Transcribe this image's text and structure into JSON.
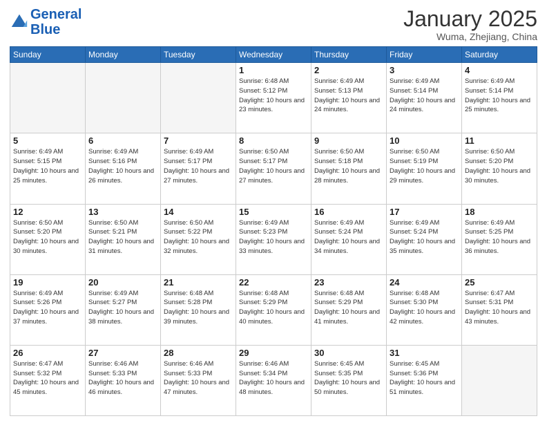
{
  "header": {
    "logo_line1": "General",
    "logo_line2": "Blue",
    "month": "January 2025",
    "location": "Wuma, Zhejiang, China"
  },
  "weekdays": [
    "Sunday",
    "Monday",
    "Tuesday",
    "Wednesday",
    "Thursday",
    "Friday",
    "Saturday"
  ],
  "weeks": [
    [
      {
        "day": "",
        "empty": true
      },
      {
        "day": "",
        "empty": true
      },
      {
        "day": "",
        "empty": true
      },
      {
        "day": "1",
        "sunrise": "6:48 AM",
        "sunset": "5:12 PM",
        "daylight": "10 hours and 23 minutes."
      },
      {
        "day": "2",
        "sunrise": "6:49 AM",
        "sunset": "5:13 PM",
        "daylight": "10 hours and 24 minutes."
      },
      {
        "day": "3",
        "sunrise": "6:49 AM",
        "sunset": "5:14 PM",
        "daylight": "10 hours and 24 minutes."
      },
      {
        "day": "4",
        "sunrise": "6:49 AM",
        "sunset": "5:14 PM",
        "daylight": "10 hours and 25 minutes."
      }
    ],
    [
      {
        "day": "5",
        "sunrise": "6:49 AM",
        "sunset": "5:15 PM",
        "daylight": "10 hours and 25 minutes."
      },
      {
        "day": "6",
        "sunrise": "6:49 AM",
        "sunset": "5:16 PM",
        "daylight": "10 hours and 26 minutes."
      },
      {
        "day": "7",
        "sunrise": "6:49 AM",
        "sunset": "5:17 PM",
        "daylight": "10 hours and 27 minutes."
      },
      {
        "day": "8",
        "sunrise": "6:50 AM",
        "sunset": "5:17 PM",
        "daylight": "10 hours and 27 minutes."
      },
      {
        "day": "9",
        "sunrise": "6:50 AM",
        "sunset": "5:18 PM",
        "daylight": "10 hours and 28 minutes."
      },
      {
        "day": "10",
        "sunrise": "6:50 AM",
        "sunset": "5:19 PM",
        "daylight": "10 hours and 29 minutes."
      },
      {
        "day": "11",
        "sunrise": "6:50 AM",
        "sunset": "5:20 PM",
        "daylight": "10 hours and 30 minutes."
      }
    ],
    [
      {
        "day": "12",
        "sunrise": "6:50 AM",
        "sunset": "5:20 PM",
        "daylight": "10 hours and 30 minutes."
      },
      {
        "day": "13",
        "sunrise": "6:50 AM",
        "sunset": "5:21 PM",
        "daylight": "10 hours and 31 minutes."
      },
      {
        "day": "14",
        "sunrise": "6:50 AM",
        "sunset": "5:22 PM",
        "daylight": "10 hours and 32 minutes."
      },
      {
        "day": "15",
        "sunrise": "6:49 AM",
        "sunset": "5:23 PM",
        "daylight": "10 hours and 33 minutes."
      },
      {
        "day": "16",
        "sunrise": "6:49 AM",
        "sunset": "5:24 PM",
        "daylight": "10 hours and 34 minutes."
      },
      {
        "day": "17",
        "sunrise": "6:49 AM",
        "sunset": "5:24 PM",
        "daylight": "10 hours and 35 minutes."
      },
      {
        "day": "18",
        "sunrise": "6:49 AM",
        "sunset": "5:25 PM",
        "daylight": "10 hours and 36 minutes."
      }
    ],
    [
      {
        "day": "19",
        "sunrise": "6:49 AM",
        "sunset": "5:26 PM",
        "daylight": "10 hours and 37 minutes."
      },
      {
        "day": "20",
        "sunrise": "6:49 AM",
        "sunset": "5:27 PM",
        "daylight": "10 hours and 38 minutes."
      },
      {
        "day": "21",
        "sunrise": "6:48 AM",
        "sunset": "5:28 PM",
        "daylight": "10 hours and 39 minutes."
      },
      {
        "day": "22",
        "sunrise": "6:48 AM",
        "sunset": "5:29 PM",
        "daylight": "10 hours and 40 minutes."
      },
      {
        "day": "23",
        "sunrise": "6:48 AM",
        "sunset": "5:29 PM",
        "daylight": "10 hours and 41 minutes."
      },
      {
        "day": "24",
        "sunrise": "6:48 AM",
        "sunset": "5:30 PM",
        "daylight": "10 hours and 42 minutes."
      },
      {
        "day": "25",
        "sunrise": "6:47 AM",
        "sunset": "5:31 PM",
        "daylight": "10 hours and 43 minutes."
      }
    ],
    [
      {
        "day": "26",
        "sunrise": "6:47 AM",
        "sunset": "5:32 PM",
        "daylight": "10 hours and 45 minutes."
      },
      {
        "day": "27",
        "sunrise": "6:46 AM",
        "sunset": "5:33 PM",
        "daylight": "10 hours and 46 minutes."
      },
      {
        "day": "28",
        "sunrise": "6:46 AM",
        "sunset": "5:33 PM",
        "daylight": "10 hours and 47 minutes."
      },
      {
        "day": "29",
        "sunrise": "6:46 AM",
        "sunset": "5:34 PM",
        "daylight": "10 hours and 48 minutes."
      },
      {
        "day": "30",
        "sunrise": "6:45 AM",
        "sunset": "5:35 PM",
        "daylight": "10 hours and 50 minutes."
      },
      {
        "day": "31",
        "sunrise": "6:45 AM",
        "sunset": "5:36 PM",
        "daylight": "10 hours and 51 minutes."
      },
      {
        "day": "",
        "empty": true
      }
    ]
  ],
  "labels": {
    "sunrise_prefix": "Sunrise: ",
    "sunset_prefix": "Sunset: ",
    "daylight_prefix": "Daylight: "
  }
}
